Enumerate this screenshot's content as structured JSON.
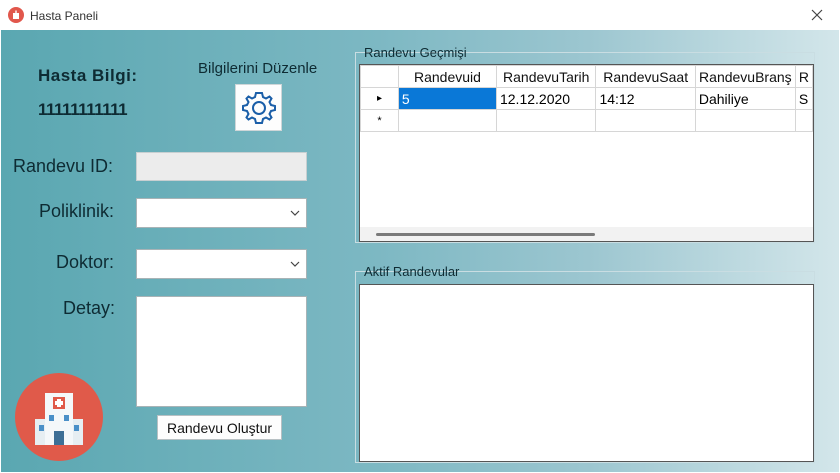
{
  "window": {
    "title": "Hasta Paneli"
  },
  "patient": {
    "header": "Hasta Bilgi:",
    "tc": "11111111111",
    "edit_label": "Bilgilerini Düzenle"
  },
  "form": {
    "randevu_id_label": "Randevu ID:",
    "randevu_id_value": "",
    "poliklinik_label": "Poliklinik:",
    "poliklinik_value": "",
    "doktor_label": "Doktor:",
    "doktor_value": "",
    "detay_label": "Detay:",
    "detay_value": "",
    "create_button": "Randevu Oluştur"
  },
  "history": {
    "title": "Randevu Geçmişi",
    "columns": [
      "Randevuid",
      "RandevuTarih",
      "RandevuSaat",
      "RandevuBranş",
      "R"
    ],
    "rows": [
      {
        "marker": "▸",
        "cells": [
          "5",
          "12.12.2020",
          "14:12",
          "Dahiliye",
          "S"
        ]
      },
      {
        "marker": "*",
        "cells": [
          "",
          "",
          "",
          "",
          ""
        ]
      }
    ]
  },
  "active": {
    "title": "Aktif Randevular"
  },
  "colors": {
    "accent": "#0a78d7",
    "logo_red": "#e05a4a",
    "bg_teal": "#5aa7b1"
  }
}
